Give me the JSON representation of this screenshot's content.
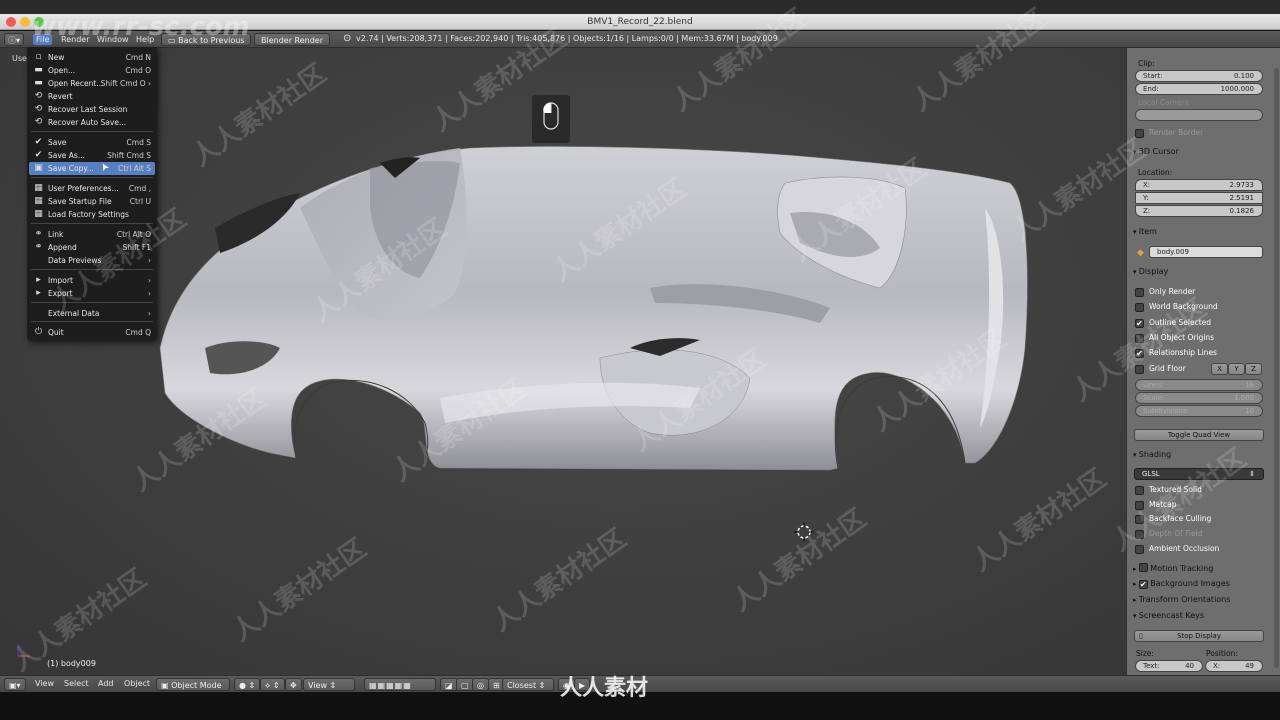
{
  "window": {
    "title": "BMV1_Record_22.blend"
  },
  "info_header": {
    "menus": [
      "File",
      "Render",
      "Window",
      "Help"
    ],
    "back_button": "Back to Previous",
    "engine": "Blender Render",
    "stats": "v2.74 | Verts:208,371 | Faces:202,940 | Tris:405,876 | Objects:1/16 | Lamps:0/0 | Mem:33.67M | body.009"
  },
  "file_menu": {
    "items": [
      {
        "icon": "new-file-icon",
        "glyph": "▫",
        "label": "New",
        "shortcut": "Cmd N"
      },
      {
        "icon": "folder-open-icon",
        "glyph": "▬",
        "label": "Open...",
        "shortcut": "Cmd O"
      },
      {
        "icon": "folder-open-icon",
        "glyph": "▬",
        "label": "Open Recent...",
        "shortcut": "Shift Cmd O ›"
      },
      {
        "icon": "revert-icon",
        "glyph": "⟲",
        "label": "Revert",
        "shortcut": ""
      },
      {
        "icon": "recover-icon",
        "glyph": "⟲",
        "label": "Recover Last Session",
        "shortcut": ""
      },
      {
        "icon": "recover-icon",
        "glyph": "⟲",
        "label": "Recover Auto Save...",
        "shortcut": ""
      },
      {
        "icon": "check-icon",
        "glyph": "✔",
        "label": "Save",
        "shortcut": "Cmd S"
      },
      {
        "icon": "check-icon",
        "glyph": "✔",
        "label": "Save As...",
        "shortcut": "Shift Cmd S"
      },
      {
        "icon": "save-copy-icon",
        "glyph": "▣",
        "label": "Save Copy...",
        "shortcut": "Ctrl Alt S"
      },
      {
        "icon": "preferences-icon",
        "glyph": "▦",
        "label": "User Preferences...",
        "shortcut": "Cmd ,"
      },
      {
        "icon": "save-startup-icon",
        "glyph": "▦",
        "label": "Save Startup File",
        "shortcut": "Ctrl U"
      },
      {
        "icon": "factory-settings-icon",
        "glyph": "▦",
        "label": "Load Factory Settings",
        "shortcut": ""
      },
      {
        "icon": "link-icon",
        "glyph": "⚭",
        "label": "Link",
        "shortcut": "Ctrl Alt O"
      },
      {
        "icon": "append-icon",
        "glyph": "⚭",
        "label": "Append",
        "shortcut": "Shift F1"
      },
      {
        "icon": "",
        "glyph": "",
        "label": "Data Previews",
        "shortcut": "›"
      },
      {
        "icon": "import-icon",
        "glyph": "▸",
        "label": "Import",
        "shortcut": "›"
      },
      {
        "icon": "export-icon",
        "glyph": "▸",
        "label": "Export",
        "shortcut": "›"
      },
      {
        "icon": "external-data-icon",
        "glyph": "",
        "label": "External Data",
        "shortcut": "›"
      },
      {
        "icon": "quit-icon",
        "glyph": "⏻",
        "label": "Quit",
        "shortcut": "Cmd Q"
      }
    ]
  },
  "viewport": {
    "view_label": "User",
    "object_label": "(1) body009"
  },
  "properties": {
    "clip_label": "Clip:",
    "clip_start": {
      "key": "Start:",
      "value": "0.100"
    },
    "clip_end": {
      "key": "End:",
      "value": "1000.000"
    },
    "local_camera": "Local Camera",
    "render_border": "Render Border",
    "cursor_header": "3D Cursor",
    "location_label": "Location:",
    "cursor_x": {
      "key": "X:",
      "value": "2.9733"
    },
    "cursor_y": {
      "key": "Y:",
      "value": "2.5191"
    },
    "cursor_z": {
      "key": "Z:",
      "value": "0.1826"
    },
    "item_header": "Item",
    "item_name": "body.009",
    "display_header": "Display",
    "display_checks": [
      {
        "label": "Only Render",
        "checked": false
      },
      {
        "label": "World Background",
        "checked": false
      },
      {
        "label": "Outline Selected",
        "checked": true
      },
      {
        "label": "All Object Origins",
        "checked": false
      },
      {
        "label": "Relationship Lines",
        "checked": true
      }
    ],
    "grid_floor": "Grid Floor",
    "axes": [
      "X",
      "Y",
      "Z"
    ],
    "lines": {
      "key": "Lines:",
      "value": "16"
    },
    "scale": {
      "key": "Scale:",
      "value": "1.000"
    },
    "subdivisions": {
      "key": "Subdivisions:",
      "value": "10"
    },
    "toggle_quad": "Toggle Quad View",
    "shading_header": "Shading",
    "shading_mode": "GLSL",
    "shading_checks": [
      {
        "label": "Textured Solid",
        "checked": false,
        "dim": false
      },
      {
        "label": "Matcap",
        "checked": false,
        "dim": false
      },
      {
        "label": "Backface Culling",
        "checked": false,
        "dim": false
      },
      {
        "label": "Depth Of Field",
        "checked": false,
        "dim": true
      },
      {
        "label": "Ambient Occlusion",
        "checked": false,
        "dim": false
      }
    ],
    "motion_tracking": "Motion Tracking",
    "background_images": "Background Images",
    "transform_orientations": "Transform Orientations",
    "screencast_keys": "Screencast Keys",
    "stop_display": "Stop Display",
    "size_label": "Size:",
    "position_label": "Position:",
    "text_size": {
      "key": "Text:",
      "value": "40"
    },
    "pos_x": {
      "key": "X:",
      "value": "49"
    }
  },
  "bottom_header": {
    "menus": [
      "View",
      "Select",
      "Add",
      "Object"
    ],
    "mode": "Object Mode",
    "pivot_view": "View",
    "snap": "Closest"
  },
  "watermark": {
    "cjk": "人人素材社区",
    "site": "www.rr-sc.com",
    "logo": "人人素材"
  }
}
